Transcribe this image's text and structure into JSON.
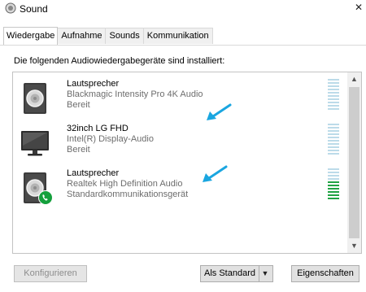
{
  "window": {
    "title": "Sound"
  },
  "tabs": [
    {
      "label": "Wiedergabe",
      "active": true
    },
    {
      "label": "Aufnahme",
      "active": false
    },
    {
      "label": "Sounds",
      "active": false
    },
    {
      "label": "Kommunikation",
      "active": false
    }
  ],
  "instruction": "Die folgenden Audiowiedergabegeräte sind installiert:",
  "devices": [
    {
      "name": "Lautsprecher",
      "description": "Blackmagic Intensity Pro 4K Audio",
      "status": "Bereit",
      "icon": "speaker-icon",
      "level": 0
    },
    {
      "name": "32inch LG FHD",
      "description": "Intel(R) Display-Audio",
      "status": "Bereit",
      "icon": "monitor-icon",
      "level": 0
    },
    {
      "name": "Lautsprecher",
      "description": "Realtek High Definition Audio",
      "status": "Standardkommunikationsgerät",
      "icon": "speaker-icon",
      "badge": "phone-icon",
      "level": 0.55
    }
  ],
  "buttons": {
    "configure": "Konfigurieren",
    "set_default": "Als Standard",
    "properties": "Eigenschaften"
  },
  "colors": {
    "annotation_arrow": "#1aa6e0",
    "meter_idle": "#bcdbe9",
    "meter_active": "#20a344",
    "badge_green": "#14a03c"
  }
}
